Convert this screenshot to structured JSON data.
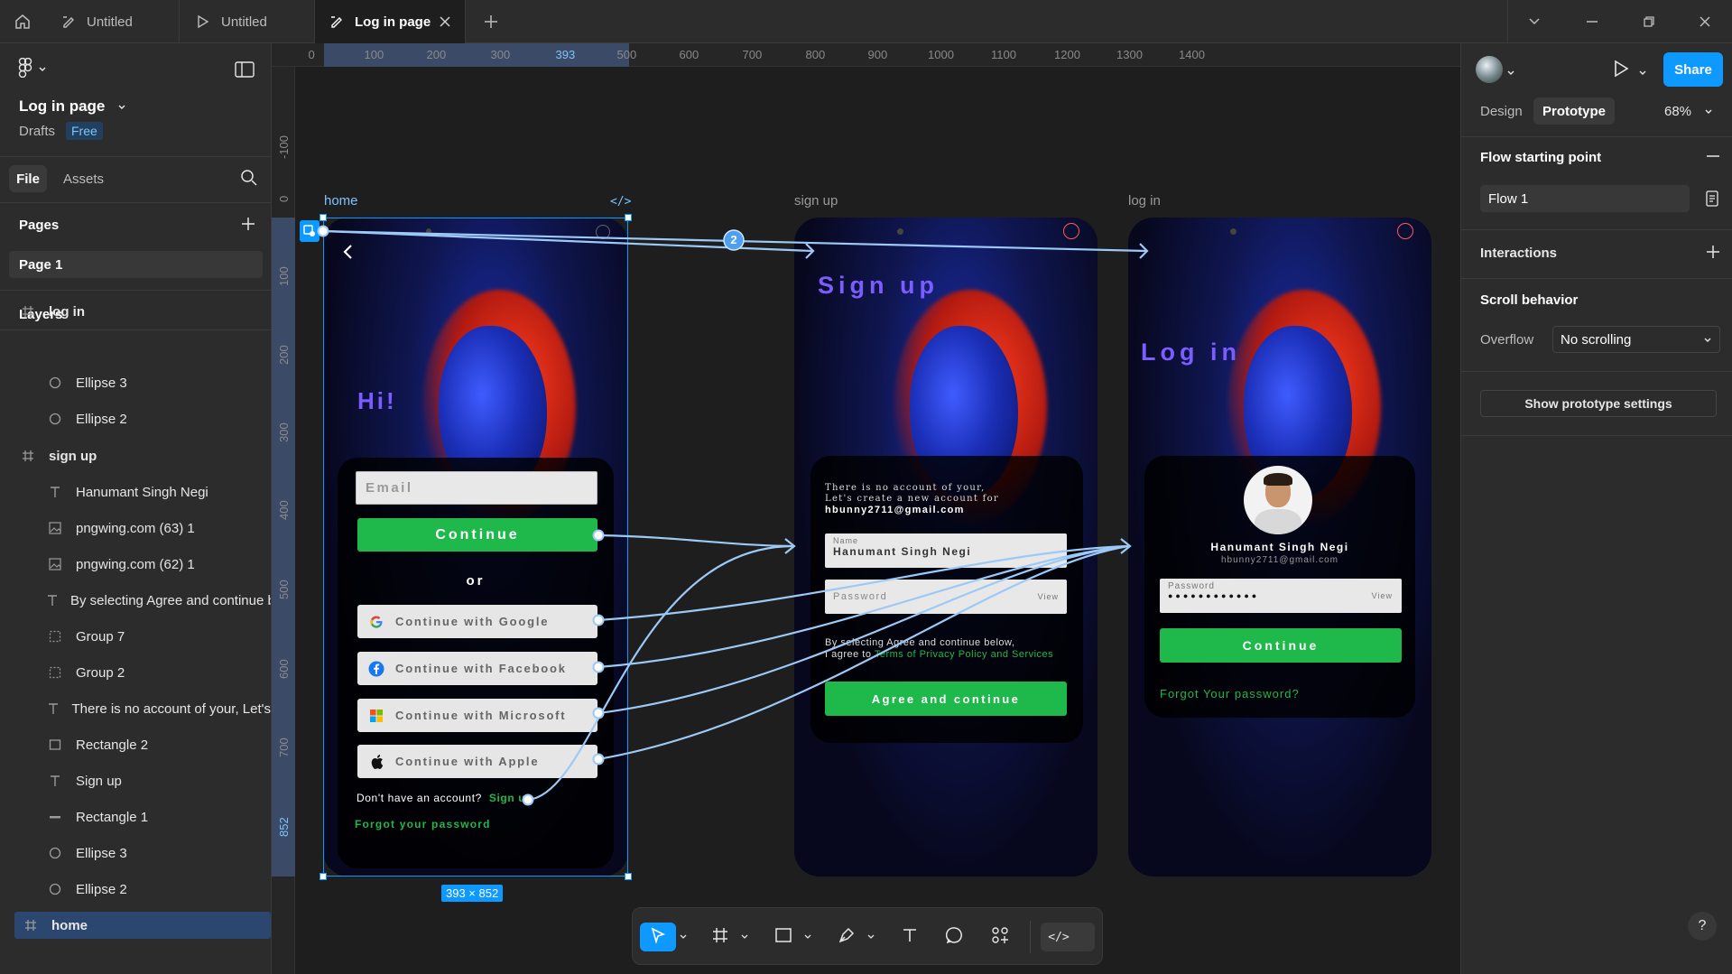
{
  "tabs": [
    {
      "label": "Untitled",
      "icon": "design-file-icon"
    },
    {
      "label": "Untitled",
      "icon": "play-icon"
    },
    {
      "label": "Log in page",
      "icon": "design-file-icon",
      "active": true
    }
  ],
  "file": {
    "name": "Log in page",
    "location": "Drafts",
    "plan": "Free"
  },
  "left_tabs": {
    "file": "File",
    "assets": "Assets"
  },
  "pages": {
    "title": "Pages",
    "items": [
      "Page 1"
    ]
  },
  "layers": {
    "title": "Layers",
    "items": [
      {
        "label": "log in",
        "icon": "frame-icon",
        "frame": true
      },
      {
        "label": "Ellipse 3",
        "icon": "ellipse-icon"
      },
      {
        "label": "Ellipse 2",
        "icon": "ellipse-icon"
      },
      {
        "label": "sign up",
        "icon": "frame-icon",
        "frame": true
      },
      {
        "label": "Hanumant Singh Negi",
        "icon": "text-icon"
      },
      {
        "label": "pngwing.com (63) 1",
        "icon": "image-icon"
      },
      {
        "label": "pngwing.com (62) 1",
        "icon": "image-icon"
      },
      {
        "label": "By selecting Agree and continue b",
        "icon": "text-icon"
      },
      {
        "label": "Group 7",
        "icon": "group-icon"
      },
      {
        "label": "Group 2",
        "icon": "group-icon"
      },
      {
        "label": "There is no account of your, Let's",
        "icon": "text-icon"
      },
      {
        "label": "Rectangle 2",
        "icon": "rectangle-icon"
      },
      {
        "label": "Sign up",
        "icon": "text-icon"
      },
      {
        "label": "Rectangle 1",
        "icon": "line-icon"
      },
      {
        "label": "Ellipse 3",
        "icon": "ellipse-icon"
      },
      {
        "label": "Ellipse 2",
        "icon": "ellipse-icon"
      },
      {
        "label": "home",
        "icon": "frame-icon",
        "frame": true,
        "selected": true
      }
    ]
  },
  "rulers": {
    "top": [
      "0",
      "100",
      "200",
      "300",
      "393",
      "500",
      "600",
      "700",
      "800",
      "900",
      "1000",
      "1100",
      "1200",
      "1300",
      "1400"
    ],
    "left": [
      "-100",
      "0",
      "100",
      "200",
      "300",
      "400",
      "500",
      "600",
      "700",
      "852"
    ]
  },
  "frames": {
    "home": {
      "label": "home",
      "title": "Hi!",
      "email_placeholder": "Email",
      "continue": "Continue",
      "or": "or",
      "google": "Continue with Google",
      "facebook": "Continue with Facebook",
      "microsoft": "Continue with Microsoft",
      "apple": "Continue with Apple",
      "no_account": "Don't have an account?",
      "sign_up_link": "Sign up",
      "forgot": "Forgot your password",
      "size_badge": "393 × 852"
    },
    "signup": {
      "label": "sign up",
      "title": "Sign up",
      "intro_line1": "There is no account of your,",
      "intro_line2": "Let's create a new account for",
      "email": "hbunny2711@gmail.com",
      "name_label": "Name",
      "name_value": "Hanumant Singh Negi",
      "password_label": "Password",
      "view": "View",
      "terms_line1": "By selecting Agree and continue below,",
      "terms_prefix": "I agree to",
      "terms_link": "Terms of Privacy Policy and Services",
      "agree_button": "Agree and continue"
    },
    "login": {
      "label": "log in",
      "title": "Log in",
      "user_name": "Hanumant Singh Negi",
      "user_email": "hbunny2711@gmail.com",
      "password_label": "Password",
      "password_mask": "●●●●●●●●●●●●",
      "view": "View",
      "continue": "Continue",
      "forgot": "Forgot Your password?"
    }
  },
  "connection_badge": "2",
  "right_panel": {
    "tabs": {
      "design": "Design",
      "prototype": "Prototype"
    },
    "zoom": "68%",
    "share": "Share",
    "flow_title": "Flow starting point",
    "flow_name": "Flow 1",
    "interactions": "Interactions",
    "scroll_title": "Scroll behavior",
    "overflow_label": "Overflow",
    "overflow_value": "No scrolling",
    "show_settings": "Show prototype settings"
  },
  "colors": {
    "accent": "#0d99ff",
    "green": "#1fb84a",
    "purple": "#7b5cff",
    "connector": "#9cc9f5"
  }
}
